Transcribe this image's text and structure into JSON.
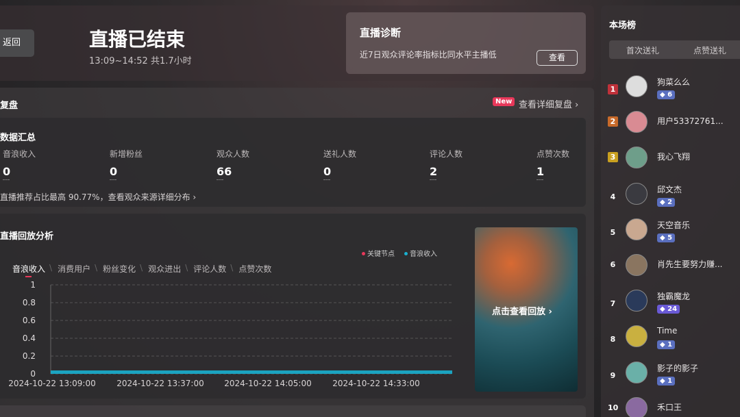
{
  "header": {
    "back_label": "返回",
    "title": "直播已结束",
    "time": "13:09~14:52 共1.7小时",
    "diagnosis": {
      "title": "直播诊断",
      "desc": "近7日观众评论率指标比同水平主播低",
      "button": "查看"
    }
  },
  "review": {
    "title": "复盘",
    "new_badge": "New",
    "detail_link": "查看详细复盘 ›"
  },
  "summary": {
    "title": "数据汇总",
    "stats": [
      {
        "label": "音浪收入",
        "value": "0"
      },
      {
        "label": "新增粉丝",
        "value": "0"
      },
      {
        "label": "观众人数",
        "value": "66"
      },
      {
        "label": "送礼人数",
        "value": "0"
      },
      {
        "label": "评论人数",
        "value": "2"
      },
      {
        "label": "点赞次数",
        "value": "1"
      }
    ],
    "recommendation": "直播推荐占比最高 90.77%，查看观众来源详细分布 ›"
  },
  "replay": {
    "title": "直播回放分析",
    "legend": [
      {
        "label": "关键节点",
        "color": "#e8385a"
      },
      {
        "label": "音浪收入",
        "color": "#1ab0d0"
      }
    ],
    "tabs": [
      "音浪收入",
      "消费用户",
      "粉丝变化",
      "观众进出",
      "评论人数",
      "点赞次数"
    ],
    "video_label": "点击查看回放 ›"
  },
  "chart_data": {
    "type": "area",
    "title": "",
    "xlabel": "",
    "ylabel": "",
    "ylim": [
      0,
      1
    ],
    "y_ticks": [
      "1",
      "0.8",
      "0.6",
      "0.4",
      "0.2",
      "0"
    ],
    "x_ticks": [
      "2024-10-22 13:09:00",
      "2024-10-22 13:37:00",
      "2024-10-22 14:05:00",
      "2024-10-22 14:33:00"
    ],
    "series": [
      {
        "name": "音浪收入",
        "color": "#1ab0d0",
        "values": [
          0,
          0,
          0,
          0,
          0
        ]
      }
    ],
    "grid": true
  },
  "rank": {
    "title": "本场榜",
    "tabs": [
      "首次送礼",
      "点赞送礼"
    ],
    "items": [
      {
        "rank": "1",
        "name": "狗菜么么",
        "badge": "6",
        "rank_color": "#c0313a",
        "avatar_color": "#ddd"
      },
      {
        "rank": "2",
        "name": "用户53372761...",
        "badge": "",
        "rank_color": "#c86a2a",
        "avatar_color": "#d98b93"
      },
      {
        "rank": "3",
        "name": "我心飞翔",
        "badge": "",
        "rank_color": "#c9a020",
        "avatar_color": "#6e9e8a"
      },
      {
        "rank": "4",
        "name": "邱文杰",
        "badge": "2",
        "rank_color": "",
        "avatar_color": "#3a3a40"
      },
      {
        "rank": "5",
        "name": "天空音乐",
        "badge": "5",
        "rank_color": "",
        "avatar_color": "#c9a890"
      },
      {
        "rank": "6",
        "name": "肖先生要努力赚...",
        "badge": "",
        "rank_color": "",
        "avatar_color": "#8a7560"
      },
      {
        "rank": "7",
        "name": "独霸魔龙",
        "badge": "24",
        "rank_color": "",
        "avatar_color": "#2a3a5a"
      },
      {
        "rank": "8",
        "name": "Time",
        "badge": "1",
        "rank_color": "",
        "avatar_color": "#c9b040"
      },
      {
        "rank": "9",
        "name": "影子的影子",
        "badge": "1",
        "rank_color": "",
        "avatar_color": "#6ab0a8"
      },
      {
        "rank": "10",
        "name": "禾口王",
        "badge": "",
        "rank_color": "",
        "avatar_color": "#8a6aa0"
      }
    ]
  }
}
